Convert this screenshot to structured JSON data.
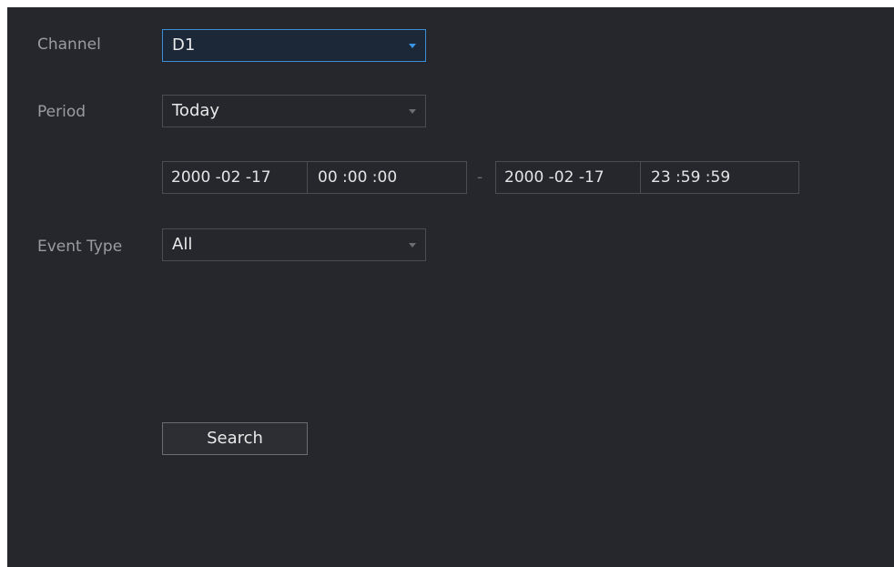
{
  "form": {
    "channel": {
      "label": "Channel",
      "value": "D1"
    },
    "period": {
      "label": "Period",
      "value": "Today"
    },
    "range": {
      "start_date": "2000 -02 -17",
      "start_time": "00 :00 :00",
      "separator": "-",
      "end_date": "2000 -02 -17",
      "end_time": "23 :59 :59"
    },
    "event_type": {
      "label": "Event Type",
      "value": "All"
    }
  },
  "actions": {
    "search_label": "Search"
  },
  "colors": {
    "panel_bg": "#26272c",
    "focus_border": "#3b8fd9",
    "label_text": "#9a9ca2"
  }
}
